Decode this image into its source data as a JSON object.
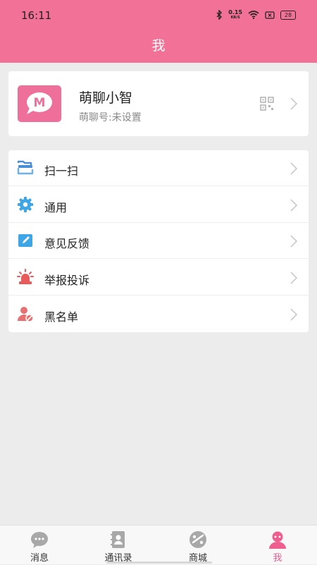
{
  "status_bar": {
    "time": "16:11",
    "net_speed": "0.15",
    "net_unit": "KB/S",
    "battery": "28"
  },
  "header": {
    "title": "我"
  },
  "profile": {
    "name": "萌聊小智",
    "id_text": "萌聊号:未设置",
    "avatar_letter": "M"
  },
  "menu": {
    "items": [
      {
        "label": "扫一扫",
        "icon": "scan-icon"
      },
      {
        "label": "通用",
        "icon": "gear-icon"
      },
      {
        "label": "意见反馈",
        "icon": "feedback-icon"
      },
      {
        "label": "举报投诉",
        "icon": "alarm-icon"
      },
      {
        "label": "黑名单",
        "icon": "blacklist-icon"
      }
    ]
  },
  "tabbar": {
    "tabs": [
      {
        "label": "消息",
        "icon": "chat-bubble-icon"
      },
      {
        "label": "通讯录",
        "icon": "contacts-book-icon"
      },
      {
        "label": "商城",
        "icon": "store-icon"
      },
      {
        "label": "我",
        "icon": "profile-icon",
        "active": true
      }
    ]
  },
  "colors": {
    "accent": "#f27197",
    "background": "#ececec",
    "active_tab": "#ee5f8f"
  }
}
